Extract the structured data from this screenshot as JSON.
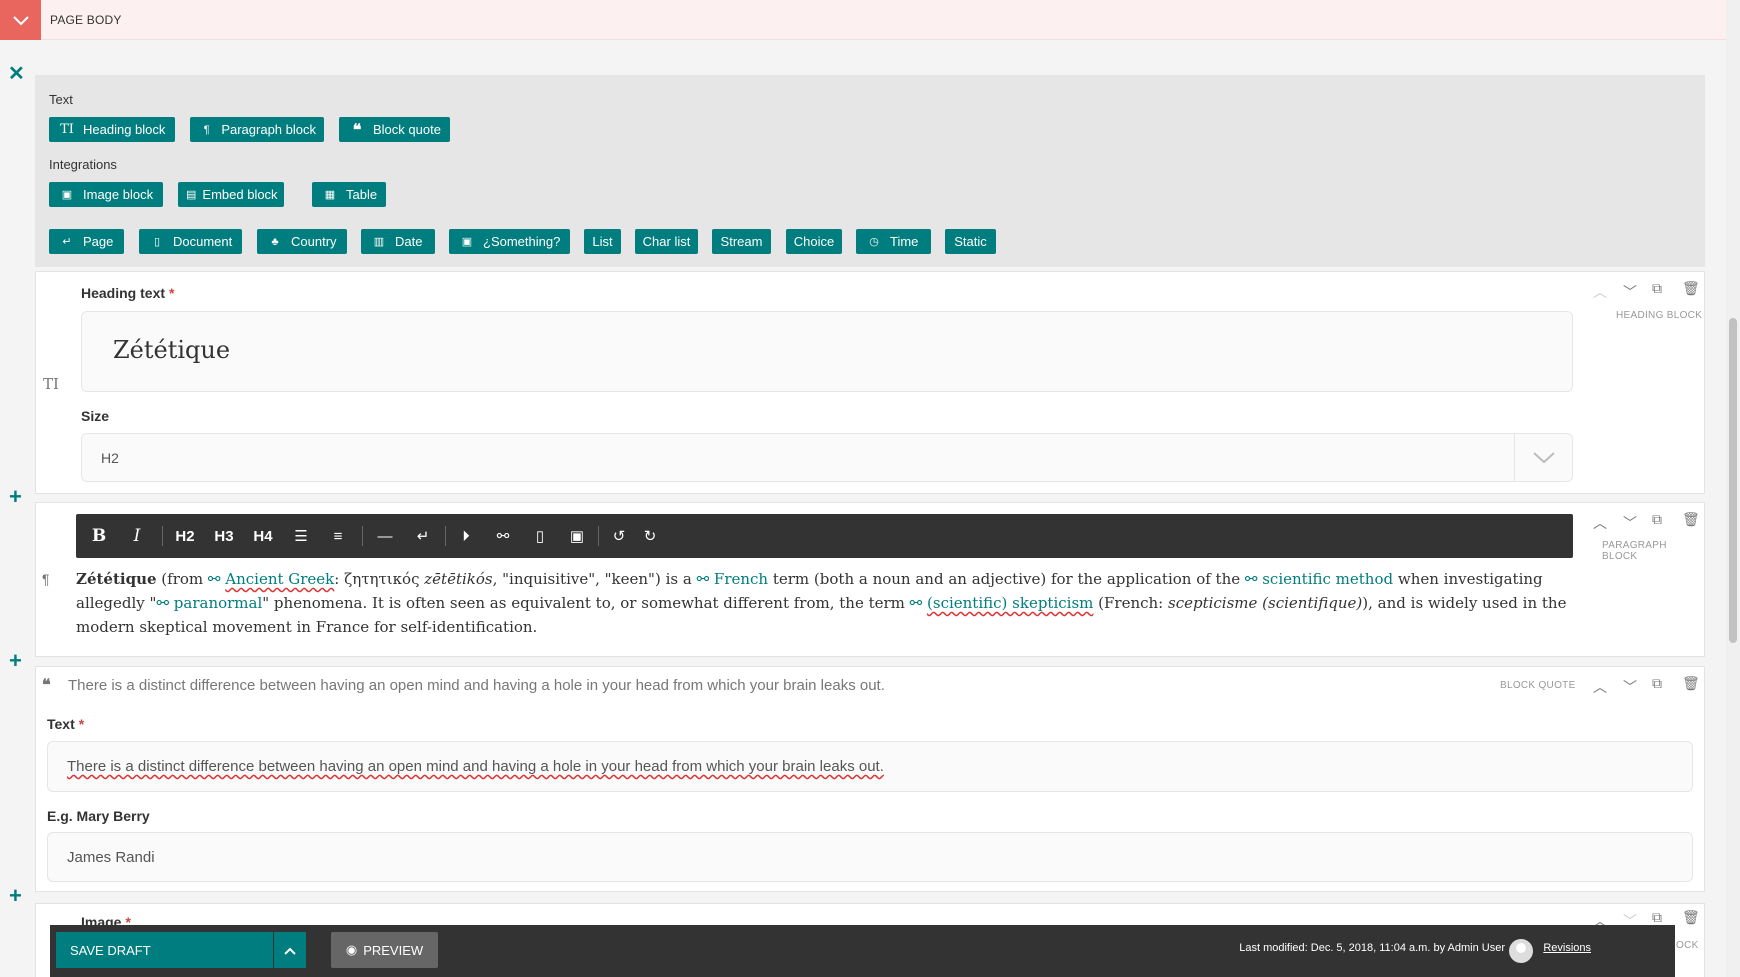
{
  "page": {
    "section_title": "PAGE BODY"
  },
  "chooser": {
    "text_group_label": "Text",
    "text_buttons": [
      "Heading block",
      "Paragraph block",
      "Block quote"
    ],
    "integrations_label": "Integrations",
    "integration_buttons": [
      "Image block",
      "Embed block",
      "Table"
    ],
    "other_buttons": [
      "Page",
      "Document",
      "Country",
      "Date",
      "¿Something?",
      "List",
      "Char list",
      "Stream",
      "Choice",
      "Time",
      "Static"
    ]
  },
  "heading_block": {
    "type_label": "HEADING BLOCK",
    "heading_label": "Heading text",
    "heading_value": "Zététique",
    "size_label": "Size",
    "size_value": "H2"
  },
  "paragraph_block": {
    "type_label": "PARAGRAPH BLOCK",
    "toolbar": [
      "B",
      "I",
      "H2",
      "H3",
      "H4"
    ],
    "segments": {
      "s1": "Zététique",
      "s2": " (from ",
      "s3": "Ancient Greek",
      "s4": ": ζητητικός ",
      "s5": "zētētikós",
      "s6": ", \"inquisitive\", \"keen\") is a ",
      "s7": "French",
      "s8": " term (both a noun and an adjective) for the application of the ",
      "s9": "scientific method",
      "s10": " when investigating allegedly \"",
      "s11": "paranormal",
      "s12": "\" phenomena. It is often seen as equivalent to, or somewhat different from, the term ",
      "s13": "(scientific) skepticism",
      "s14": " (French: ",
      "s15": "scepticisme (scientifique)",
      "s16": "), and is widely used in the modern skeptical movement in France for self-identification."
    }
  },
  "quote_block": {
    "type_label": "BLOCK QUOTE",
    "summary": "There is a distinct difference between having an open mind and having a hole in your head from which your brain leaks out.",
    "text_label": "Text",
    "text_value": "There is a distinct difference between having an open mind and having a hole in your head from which your brain leaks out.",
    "attribution_label": "E.g. Mary Berry",
    "attribution_value": "James Randi"
  },
  "image_block": {
    "label": "Image",
    "type_label": "OCK"
  },
  "footer": {
    "save_label": "SAVE DRAFT",
    "preview_label": "PREVIEW",
    "last_modified": "Last modified: Dec. 5, 2018, 11:04 a.m. by Admin User",
    "revisions_label": "Revisions"
  }
}
